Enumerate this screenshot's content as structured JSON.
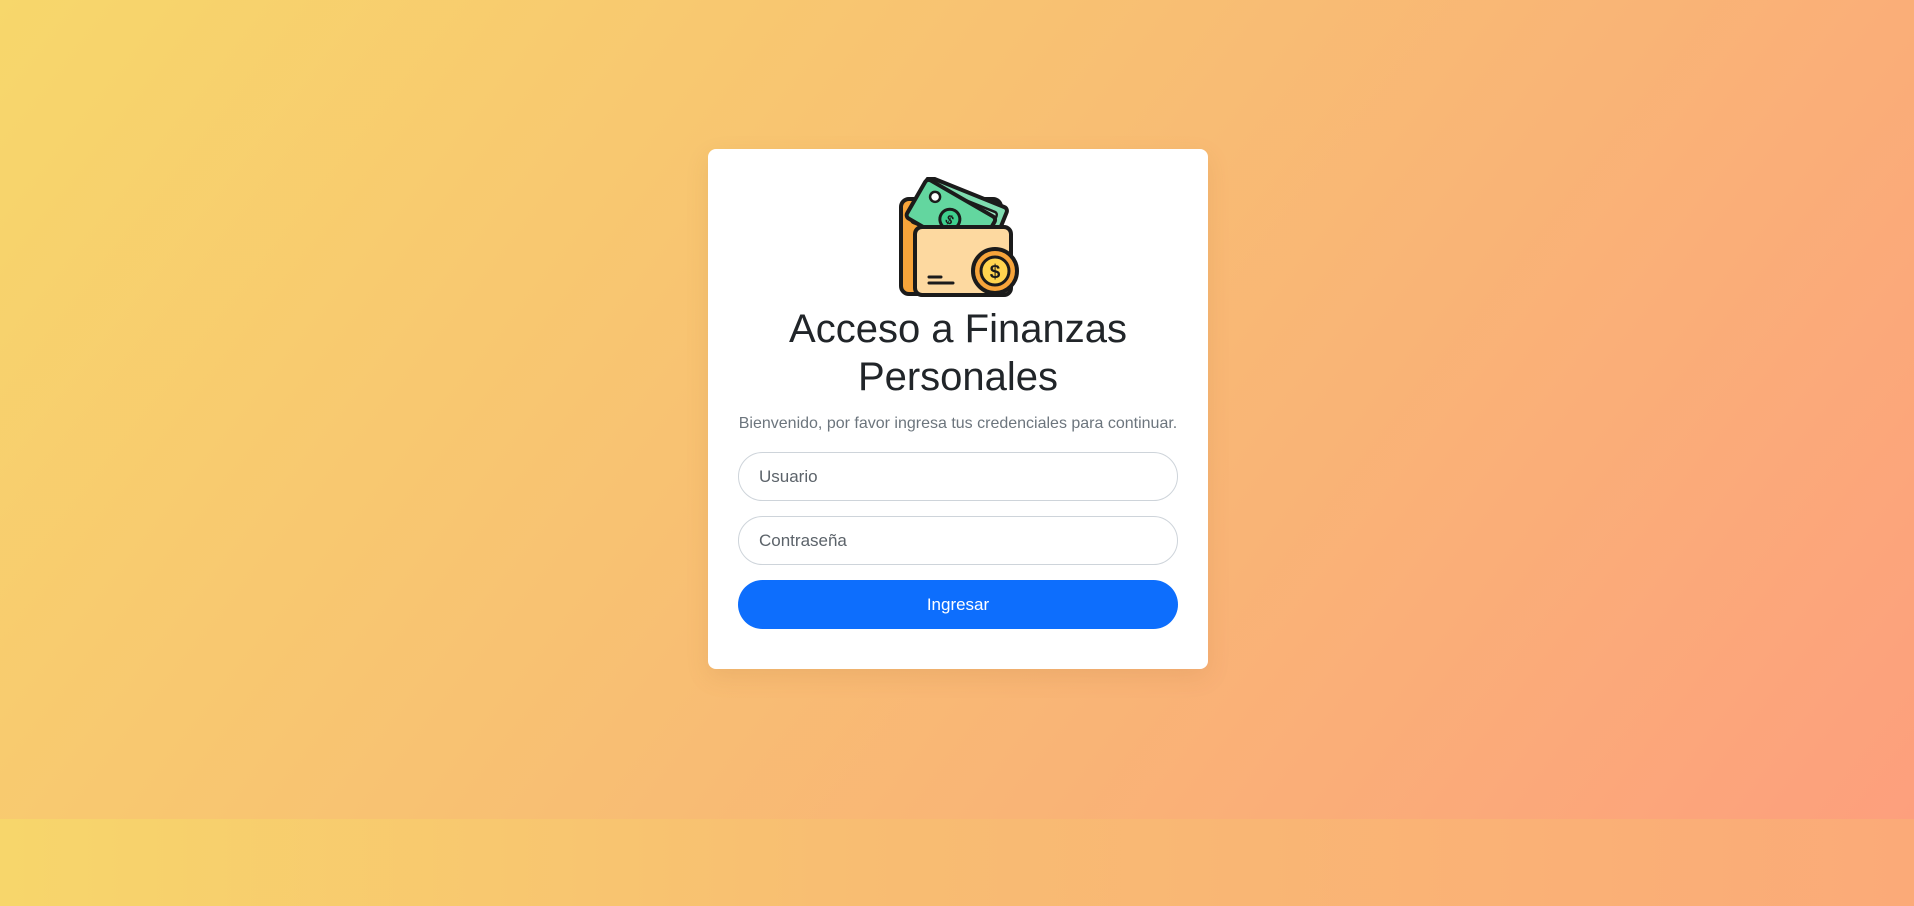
{
  "login": {
    "title": "Acceso a Finanzas Personales",
    "subtitle": "Bienvenido, por favor ingresa tus credenciales para continuar.",
    "username_placeholder": "Usuario",
    "username_value": "",
    "password_placeholder": "Contraseña",
    "password_value": "",
    "submit_label": "Ingresar"
  },
  "logo": {
    "icon": "wallet-money-icon"
  },
  "colors": {
    "primary_button": "#0d6efd",
    "card_background": "#ffffff",
    "background_gradient_start": "#f7d76b",
    "background_gradient_end": "#fd9f7d"
  }
}
